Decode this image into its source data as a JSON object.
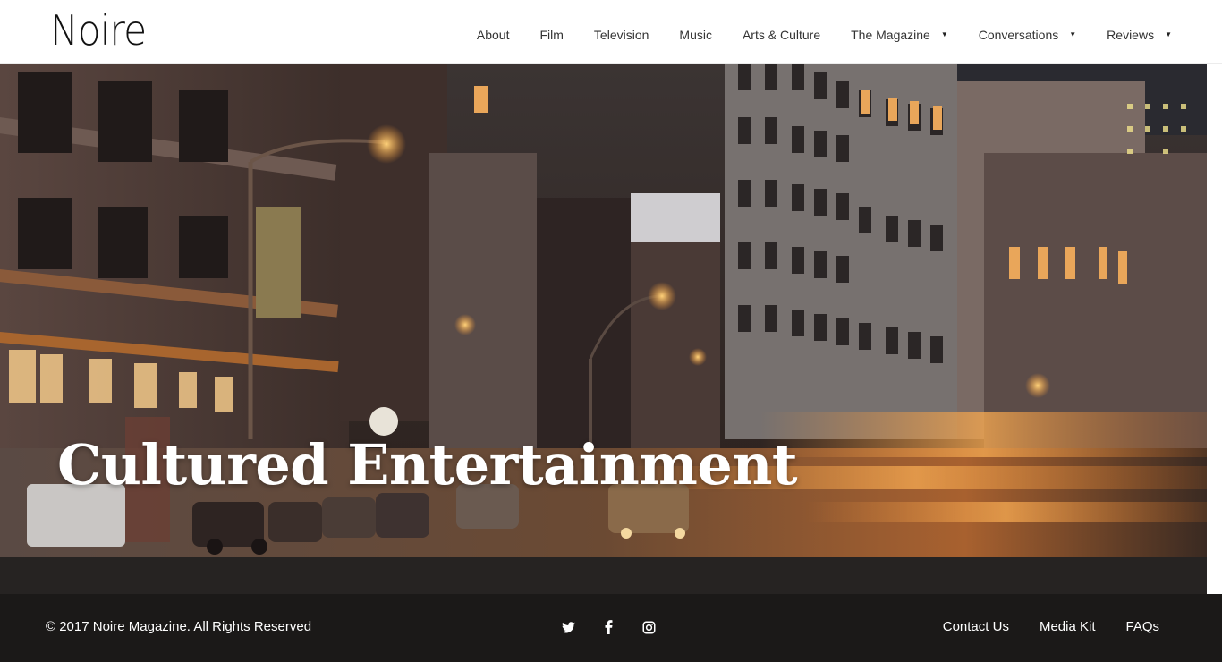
{
  "brand": {
    "logo": "Noire"
  },
  "nav": {
    "items": [
      {
        "label": "About",
        "has_dropdown": false
      },
      {
        "label": "Film",
        "has_dropdown": false
      },
      {
        "label": "Television",
        "has_dropdown": false
      },
      {
        "label": "Music",
        "has_dropdown": false
      },
      {
        "label": "Arts & Culture",
        "has_dropdown": false
      },
      {
        "label": "The Magazine",
        "has_dropdown": true
      },
      {
        "label": "Conversations",
        "has_dropdown": true
      },
      {
        "label": "Reviews",
        "has_dropdown": true
      }
    ],
    "caret": "▼"
  },
  "hero": {
    "title": "Cultured Entertainment"
  },
  "footer": {
    "copyright": "© 2017 Noire Magazine. All Rights Reserved",
    "social": [
      "twitter-icon",
      "facebook-icon",
      "instagram-icon"
    ],
    "links": [
      "Contact Us",
      "Media Kit",
      "FAQs"
    ]
  },
  "colors": {
    "footer_bg": "#1b1918",
    "band_bg": "#262322",
    "text_dark": "#333333",
    "text_light": "#ffffff"
  }
}
